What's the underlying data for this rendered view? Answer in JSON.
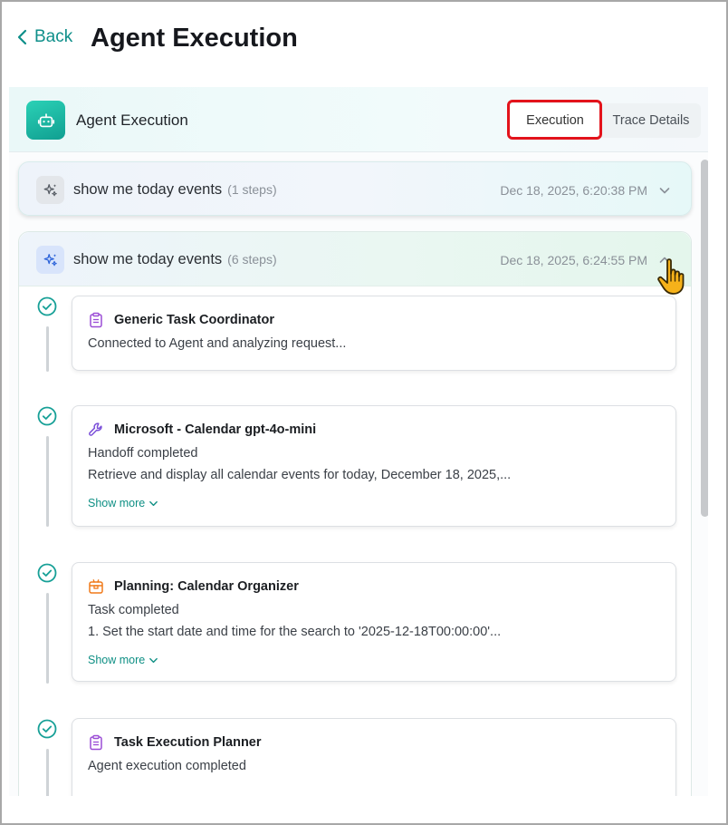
{
  "header": {
    "back_label": "Back",
    "page_title": "Agent Execution"
  },
  "panel": {
    "title": "Agent Execution",
    "tabs": [
      {
        "label": "Execution",
        "active": true
      },
      {
        "label": "Trace Details",
        "active": false
      }
    ]
  },
  "runs": [
    {
      "title": "show me today events",
      "steps_label": "(1 steps)",
      "date": "Dec 18, 2025, 6:20:38 PM",
      "expanded": false
    },
    {
      "title": "show me today events",
      "steps_label": "(6 steps)",
      "date": "Dec 18, 2025, 6:24:55 PM",
      "expanded": true,
      "steps": [
        {
          "icon": "clipboard-icon",
          "title": "Generic Task Coordinator",
          "line1": "Connected to Agent and analyzing request..."
        },
        {
          "icon": "wrench-icon",
          "title": "Microsoft - Calendar gpt-4o-mini",
          "line1": "Handoff completed",
          "line2": "Retrieve and display all calendar events for today, December 18, 2025,...",
          "show_more": "Show more"
        },
        {
          "icon": "package-icon",
          "title": "Planning: Calendar Organizer",
          "line1": "Task completed",
          "line2": "1. Set the start date and time for the search to '2025-12-18T00:00:00'...",
          "show_more": "Show more"
        },
        {
          "icon": "clipboard-icon",
          "title": "Task Execution Planner",
          "line1": "Agent execution completed"
        }
      ]
    }
  ],
  "colors": {
    "accent": "#0f8f8a",
    "highlight": "#e3131b",
    "check": "#17a097",
    "clipboard": "#9b4dd6",
    "wrench": "#7b4fd9",
    "package": "#f07a1a"
  }
}
